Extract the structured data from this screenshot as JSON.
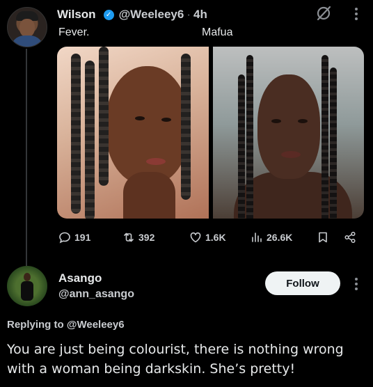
{
  "tweet": {
    "author_name": "Wilson",
    "author_emoji": "",
    "handle": "@Weeleey6",
    "separator": "·",
    "time": "4h",
    "caption_left": "Fever.",
    "caption_right": "Mafua",
    "stats": {
      "replies": "191",
      "reposts": "392",
      "likes": "1.6K",
      "views": "26.6K"
    }
  },
  "reply": {
    "author_name": "Asango",
    "handle": "@ann_asango",
    "follow_label": "Follow",
    "replying_to": "Replying to @Weeleey6",
    "text": "You are just being colourist, there is nothing wrong with a woman being darkskin. She’s pretty!"
  },
  "colors": {
    "background": "#000000",
    "text_primary": "#e7e9ea",
    "text_secondary": "#c9ccd0",
    "verified_blue": "#1d9bf0",
    "follow_button_bg": "#eff3f4"
  },
  "icons": [
    "verified-badge-icon",
    "grok-icon",
    "more-icon",
    "reply-icon",
    "repost-icon",
    "like-icon",
    "views-icon",
    "bookmark-icon",
    "share-icon"
  ]
}
